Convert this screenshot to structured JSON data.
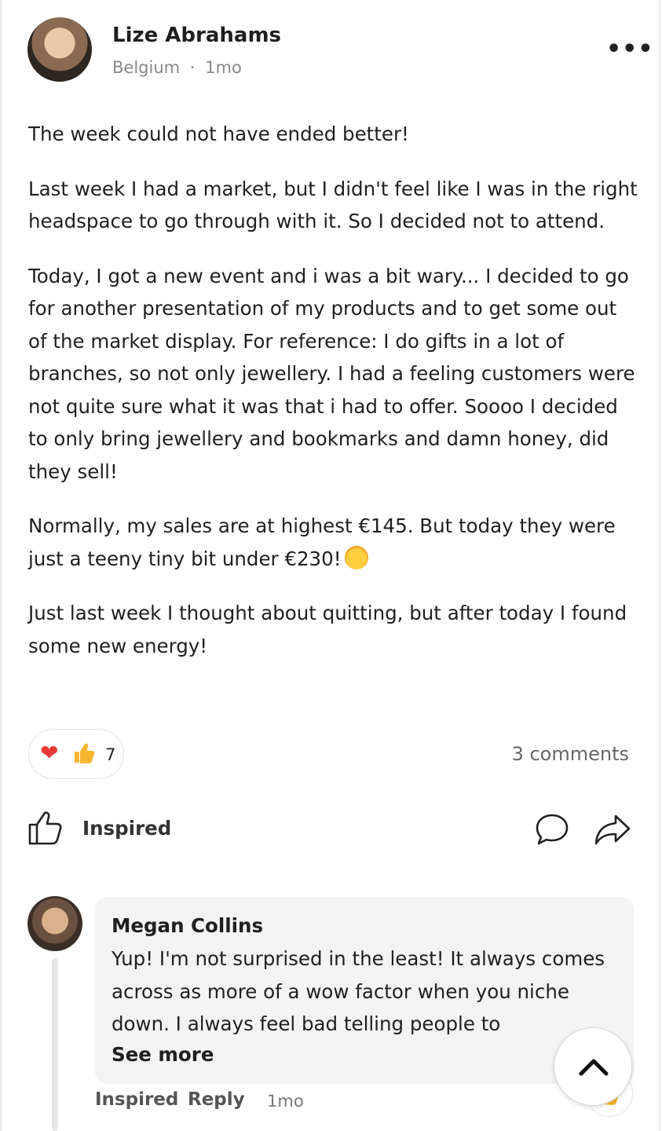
{
  "post": {
    "author": "Lize Abrahams",
    "location": "Belgium",
    "separator": "·",
    "time": "1mo",
    "more_label": "•••",
    "paragraphs": [
      "The week could not have ended better!",
      "Last week I had a market, but I didn't feel like I was in the right headspace to go through with it. So I decided not to attend.",
      "Today, I got a new event and i was a bit wary... I decided to go for another presentation of my products and to get some out of the market display. For reference: I do gifts in a lot of branches, so not only jewellery. I had a feeling customers were not quite sure what it was that i had to offer. Soooo I decided to only bring jewellery and bookmarks and damn honey, did they sell!",
      "Normally, my sales are at highest €145. But today they were just a teeny tiny bit under €230!",
      "Just last week I thought about quitting, but after today I found some new energy!"
    ],
    "reaction_count": "7",
    "comments_count": "3 comments",
    "like_label": "Inspired"
  },
  "comment": {
    "author": "Megan Collins",
    "text": "Yup! I'm not surprised in the least! It always comes across as more of a wow factor when you niche down. I always feel bad telling people to",
    "see_more": "See more",
    "inspired_label": "Inspired",
    "reply_label": "Reply",
    "time": "1mo"
  },
  "colors": {
    "heart": "#e53935",
    "thumb": "#f5b52e",
    "bubble": "#f3f3f3"
  },
  "icons": [
    "more-icon",
    "heart-icon",
    "thumbs-up-icon",
    "like-icon",
    "comment-icon",
    "share-icon",
    "chevron-up-icon"
  ]
}
